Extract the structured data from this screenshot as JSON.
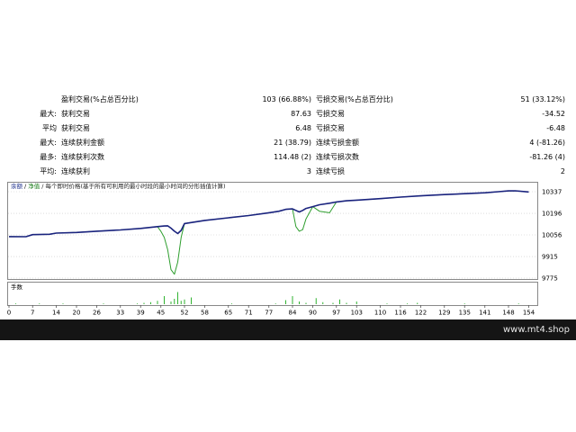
{
  "stats": {
    "rows": [
      {
        "l1": "",
        "l2": "盈利交易(%占总百分比)",
        "v1": "103 (66.88%)",
        "l3": "亏损交易(%占总百分比)",
        "v2": "51 (33.12%)"
      },
      {
        "l1": "最大:",
        "l2": "获利交易",
        "v1": "87.63",
        "l3": "亏损交易",
        "v2": "-34.52"
      },
      {
        "l1": "平均",
        "l2": "获利交易",
        "v1": "6.48",
        "l3": "亏损交易",
        "v2": "-6.48"
      },
      {
        "l1": "最大:",
        "l2": "连续获利金额",
        "v1": "21 (38.79)",
        "l3": "连续亏损金额",
        "v2": "4 (-81.26)"
      },
      {
        "l1": "最多:",
        "l2": "连续获利次数",
        "v1": "114.48 (2)",
        "l3": "连续亏损次数",
        "v2": "-81.26 (4)"
      },
      {
        "l1": "平均:",
        "l2": "连续获利",
        "v1": "3",
        "l3": "连续亏损",
        "v2": "2"
      }
    ]
  },
  "chart": {
    "legend_balance": "余额",
    "legend_sep": "/",
    "legend_equity": "净值",
    "legend_desc": "/ 每个即时价格(基于所有可利用的最小时段的最小时间的分形插值计算)",
    "volume_label": "手数",
    "colors": {
      "balance": "#1a237e",
      "equity": "#2e9e2e",
      "volume": "#31b331",
      "grid": "#c8c8c8"
    }
  },
  "chart_data": {
    "type": "line",
    "x_ticks": [
      "0",
      "7",
      "14",
      "20",
      "26",
      "33",
      "39",
      "45",
      "52",
      "58",
      "65",
      "71",
      "77",
      "84",
      "90",
      "97",
      "103",
      "110",
      "116",
      "122",
      "129",
      "135",
      "141",
      "148",
      "154"
    ],
    "y_ticks": [
      "10337",
      "10196",
      "10056",
      "9915",
      "9775"
    ],
    "ylim": [
      9775,
      10337
    ],
    "xlim": [
      0,
      156
    ],
    "series": [
      {
        "name": "余额",
        "x": [
          0,
          5,
          7,
          12,
          14,
          20,
          26,
          33,
          39,
          44,
          45,
          46,
          47,
          48,
          49,
          50,
          51,
          52,
          58,
          65,
          71,
          77,
          80,
          82,
          84,
          85,
          86,
          87,
          88,
          90,
          92,
          95,
          97,
          100,
          103,
          110,
          116,
          122,
          129,
          135,
          141,
          145,
          148,
          150,
          154
        ],
        "values": [
          10045,
          10044,
          10058,
          10060,
          10068,
          10072,
          10080,
          10088,
          10098,
          10110,
          10112,
          10114,
          10115,
          10100,
          10080,
          10065,
          10085,
          10130,
          10150,
          10167,
          10182,
          10200,
          10210,
          10222,
          10225,
          10215,
          10205,
          10215,
          10228,
          10240,
          10252,
          10262,
          10270,
          10278,
          10282,
          10292,
          10302,
          10310,
          10318,
          10324,
          10330,
          10337,
          10342,
          10343,
          10335
        ]
      },
      {
        "name": "净值",
        "x": [
          0,
          5,
          7,
          12,
          14,
          20,
          26,
          33,
          39,
          44,
          45,
          46,
          47,
          48,
          49,
          50,
          51,
          52,
          58,
          65,
          71,
          77,
          80,
          82,
          84,
          85,
          86,
          87,
          88,
          90,
          92,
          95,
          97,
          100,
          103,
          110,
          116,
          122,
          129,
          135,
          141,
          145,
          148,
          150,
          154
        ],
        "values": [
          10045,
          10044,
          10058,
          10060,
          10068,
          10072,
          10080,
          10088,
          10098,
          10110,
          10080,
          10040,
          9960,
          9830,
          9800,
          9880,
          10040,
          10130,
          10150,
          10167,
          10182,
          10200,
          10210,
          10222,
          10225,
          10110,
          10080,
          10090,
          10160,
          10240,
          10210,
          10200,
          10270,
          10278,
          10282,
          10292,
          10302,
          10310,
          10318,
          10324,
          10330,
          10337,
          10342,
          10343,
          10335
        ]
      }
    ],
    "volume": {
      "x": [
        2,
        9,
        16,
        28,
        38,
        40,
        42,
        44,
        46,
        48,
        49,
        50,
        51,
        52,
        54,
        66,
        79,
        82,
        84,
        86,
        88,
        91,
        93,
        96,
        98,
        100,
        103,
        112,
        118,
        121,
        135,
        151
      ],
      "values": [
        0.05,
        0.05,
        0.05,
        0.05,
        0.05,
        0.1,
        0.15,
        0.25,
        0.6,
        0.2,
        0.4,
        0.9,
        0.25,
        0.35,
        0.5,
        0.05,
        0.05,
        0.3,
        0.6,
        0.2,
        0.1,
        0.45,
        0.15,
        0.1,
        0.35,
        0.1,
        0.2,
        0.05,
        0.05,
        0.1,
        0.05,
        0.05
      ]
    }
  },
  "footer": {
    "site": "www.mt4.shop"
  }
}
